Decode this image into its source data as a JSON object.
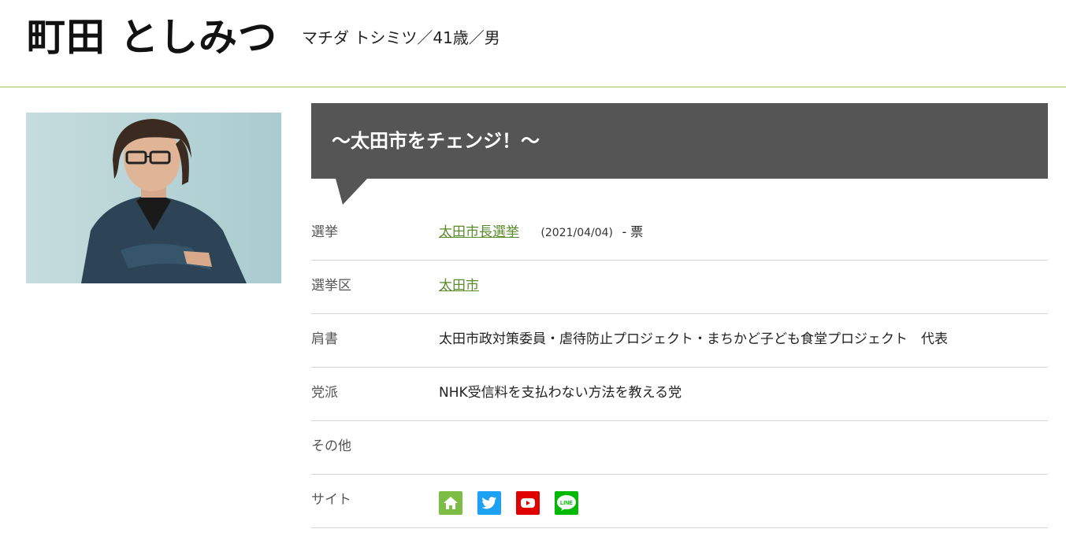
{
  "profile": {
    "name": "町田 としみつ",
    "meta": "マチダ トシミツ／41歳／男"
  },
  "catchphrase": "〜太田市をチェンジ！〜",
  "details": {
    "election": {
      "label": "選挙",
      "link_text": "太田市長選挙",
      "date": "(2021/04/04)",
      "votes": "- 票"
    },
    "district": {
      "label": "選挙区",
      "link_text": "太田市"
    },
    "title": {
      "label": "肩書",
      "value": "太田市政対策委員・虐待防止プロジェクト・まちかど子ども食堂プロジェクト　代表"
    },
    "party": {
      "label": "党派",
      "value": "NHK受信料を支払わない方法を教える党"
    },
    "other": {
      "label": "その他",
      "value": ""
    },
    "sites": {
      "label": "サイト",
      "icons": [
        "home-icon",
        "twitter-icon",
        "youtube-icon",
        "line-icon"
      ],
      "line_text": "LINE"
    }
  },
  "colors": {
    "accent_green": "#5a8a2a",
    "header_rule": "#9bc45a",
    "catch_bg": "#555555",
    "home": "#7cbd45",
    "twitter": "#1da1f2",
    "youtube": "#e00000",
    "line": "#00b900"
  }
}
